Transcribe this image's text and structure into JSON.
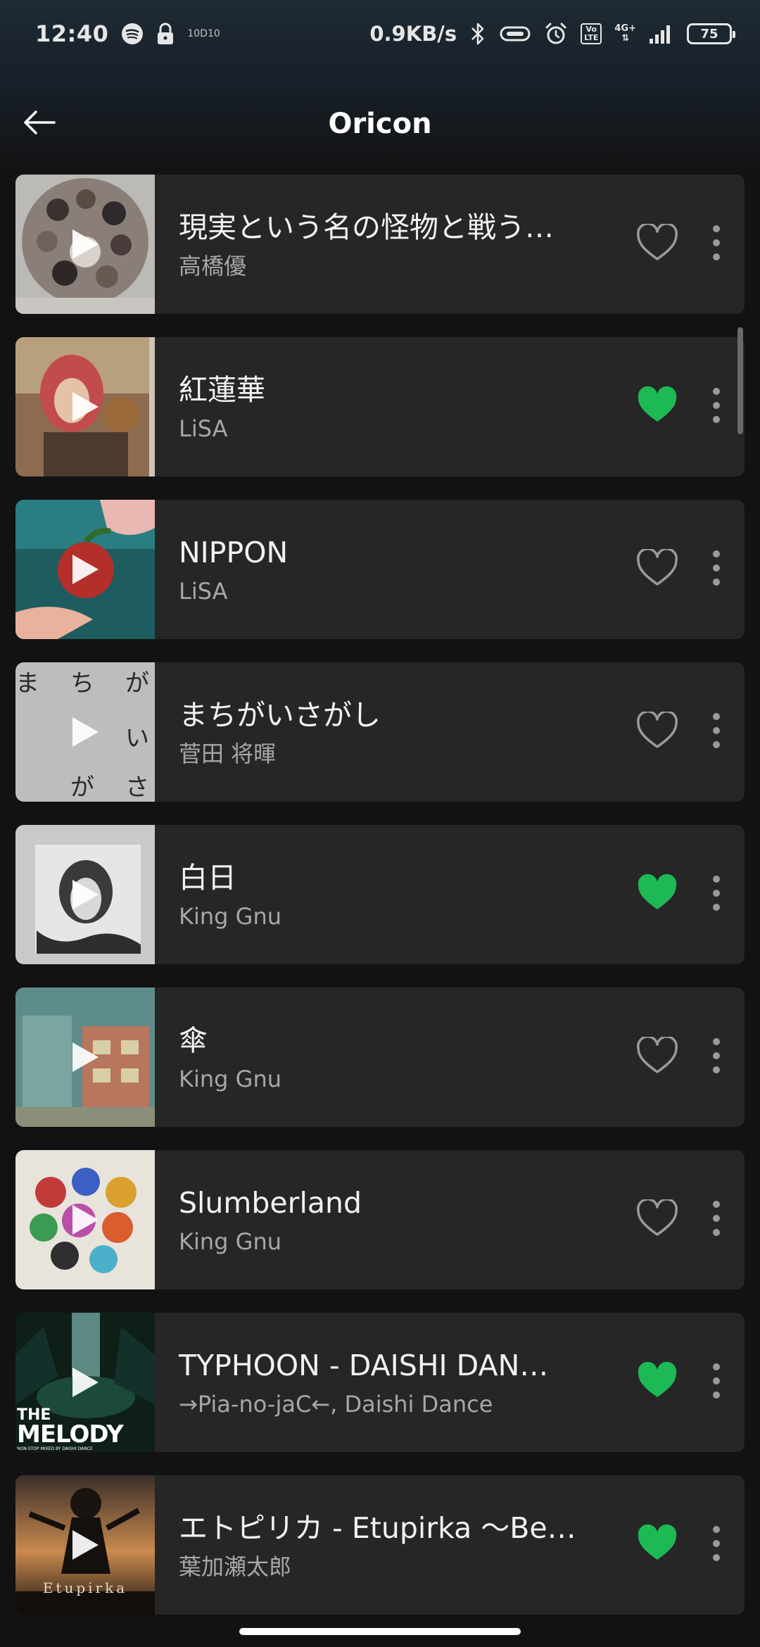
{
  "status_bar": {
    "time": "12:40",
    "net_speed": "0.9KB/s",
    "carrier_tag": "10D10",
    "volte": "Vo\nLTE",
    "network": "4G+",
    "battery": "75"
  },
  "header": {
    "title": "Oricon"
  },
  "tracks": [
    {
      "title": "現実という名の怪物と戦う…",
      "artist": "高橋優",
      "liked": false
    },
    {
      "title": "紅蓮華",
      "artist": "LiSA",
      "liked": true
    },
    {
      "title": "NIPPON",
      "artist": "LiSA",
      "liked": false
    },
    {
      "title": "まちがいさがし",
      "artist": "菅田 将暉",
      "liked": false
    },
    {
      "title": "白日",
      "artist": "King Gnu",
      "liked": true
    },
    {
      "title": "傘",
      "artist": "King Gnu",
      "liked": false
    },
    {
      "title": "Slumberland",
      "artist": "King Gnu",
      "liked": false
    },
    {
      "title": "TYPHOON - DAISHI DAN…",
      "artist": "→Pia-no-jaC←, Daishi Dance",
      "liked": true
    },
    {
      "title": "エトピリカ - Etupirka 〜Be…",
      "artist": "葉加瀬太郎",
      "liked": true
    }
  ],
  "covers": {
    "cover4": [
      "ま",
      "ち",
      "が",
      "い",
      "が",
      "さ"
    ],
    "cover8": {
      "line1": "THE",
      "line2": "MELODY",
      "line3": "NON-STOP MIXED BY DAISHI DANCE"
    },
    "cover9": "Etupirka"
  },
  "colors": {
    "accent": "#1DB954",
    "row_bg": "#262626",
    "screen_bg": "#121212"
  }
}
